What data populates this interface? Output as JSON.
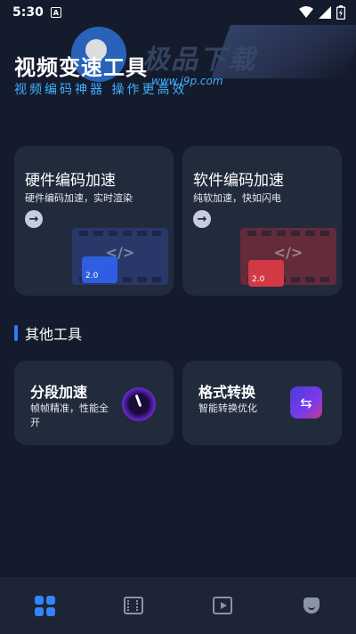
{
  "status_bar": {
    "time": "5:30",
    "notification_icon": "A"
  },
  "header": {
    "title": "视频变速工具",
    "subtitle": "视频编码神器 操作更高效"
  },
  "watermark": {
    "text": "极品下载",
    "url": "www.j9p.com"
  },
  "encode_cards": [
    {
      "title": "硬件编码加速",
      "desc": "硬件编码加速，实时渲染",
      "badge": "2.0",
      "code_glyph": "</>"
    },
    {
      "title": "软件编码加速",
      "desc": "纯软加速，快如闪电",
      "badge": "2.0",
      "code_glyph": "</>"
    }
  ],
  "section": {
    "title": "其他工具"
  },
  "tools": [
    {
      "title": "分段加速",
      "desc": "帧帧精准，性能全开"
    },
    {
      "title": "格式转换",
      "desc": "智能转换优化"
    }
  ],
  "bottom_nav": [
    {
      "icon": "grid-icon",
      "active": true
    },
    {
      "icon": "film-icon",
      "active": false
    },
    {
      "icon": "play-icon",
      "active": false
    },
    {
      "icon": "face-icon",
      "active": false
    }
  ],
  "colors": {
    "background": "#141b2c",
    "card": "#222b3c",
    "accent": "#3584ff",
    "subtitle": "#3fb0ff"
  }
}
